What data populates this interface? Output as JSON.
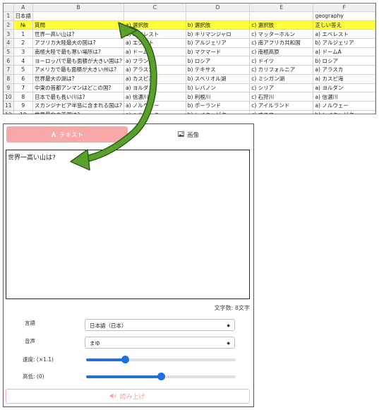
{
  "sheet": {
    "columns": [
      "",
      "A",
      "B",
      "C",
      "D",
      "E",
      "F"
    ],
    "rows": [
      {
        "num": "1",
        "cells": [
          "日本語",
          "",
          "",
          "",
          "",
          "geography"
        ]
      },
      {
        "num": "2",
        "cells": [
          "№",
          "質問",
          "a) 選択肢",
          "b) 選択肢",
          "c) 選択肢",
          "正しい答え"
        ]
      },
      {
        "num": "3",
        "cells": [
          "1",
          "世界一高い山は?",
          "a) エベレスト",
          "b) キリマンジャロ",
          "c) マッターホルン",
          "a) エベレスト"
        ]
      },
      {
        "num": "4",
        "cells": [
          "2",
          "アフリカ大陸最大の国は?",
          "a) エジプト",
          "b) アルジェリア",
          "c) 南アフリカ共和国",
          "b) アルジェリア"
        ]
      },
      {
        "num": "5",
        "cells": [
          "3",
          "南極大陸で最も寒い場所は?",
          "a) ドームA",
          "b) マクマード",
          "c) 南極高原",
          "a) ドームA"
        ]
      },
      {
        "num": "6",
        "cells": [
          "4",
          "ヨーロッパで最も面積が大きい国は?",
          "a) フランス",
          "b) ロシア",
          "c) ドイツ",
          "b) ロシア"
        ]
      },
      {
        "num": "7",
        "cells": [
          "5",
          "アメリカで最も面積が大きい州は?",
          "a) アラスカ",
          "b) テキサス",
          "c) カリフォルニア",
          "a) アラスカ"
        ]
      },
      {
        "num": "8",
        "cells": [
          "6",
          "世界最大の湖は?",
          "a) カスピ海",
          "b) スペリオル湖",
          "c) ミシガン湖",
          "a) カスピ海"
        ]
      },
      {
        "num": "9",
        "cells": [
          "7",
          "中東の首都アンマンはどこの国?",
          "a) ヨルダン",
          "b) レバノン",
          "c) シリア",
          "a) ヨルダン"
        ]
      },
      {
        "num": "10",
        "cells": [
          "8",
          "日本で最も長い川は?",
          "a) 信濃川",
          "b) 利根川",
          "c) 石狩川",
          "a) 信濃川"
        ]
      },
      {
        "num": "11",
        "cells": [
          "9",
          "スカンジナビア半島に含まれる国は?",
          "a) ノルウェー",
          "b) ポーランド",
          "c) アイルランド",
          "a) ノルウェー"
        ]
      },
      {
        "num": "12",
        "cells": [
          "10",
          "世界最北の首都は?",
          "a) ヘルシンキ",
          "b) レイキャビク",
          "c) オスロ",
          "b) レイキャビク"
        ]
      }
    ],
    "header_color": "#ffff3a"
  },
  "tts": {
    "tabs": [
      {
        "label": "テキスト",
        "icon": "text-icon"
      },
      {
        "label": "画像",
        "icon": "image-icon"
      }
    ],
    "text_value": "世界一高い山は?",
    "char_count": "文字数: 8文字",
    "language_label": "言語",
    "language_value": "日本語（日本）",
    "voice_label": "音声",
    "voice_value": "まゆ",
    "speed_label": "速度: (×1.1)",
    "speed_fraction": 0.26,
    "pitch_label": "高低: (0)",
    "pitch_fraction": 0.5,
    "read_button": "読み上げ",
    "read_icon": "speaker-icon",
    "accent_color": "#f7a8a8",
    "slider_color": "#1f6fe0"
  },
  "annotation": {
    "arrow_color": "#4f8a2a"
  }
}
